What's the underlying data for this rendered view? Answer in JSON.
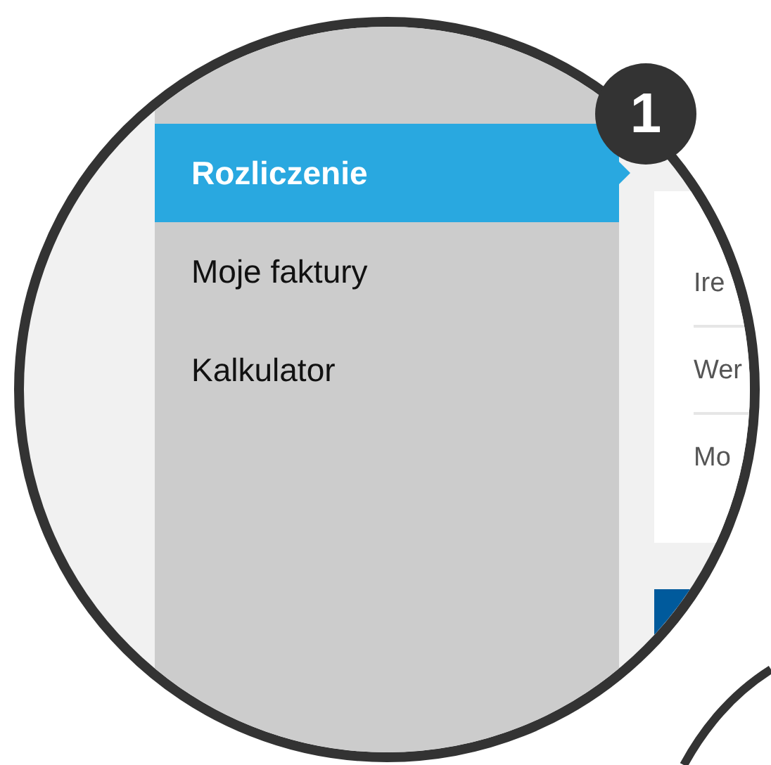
{
  "badge": {
    "label": "1"
  },
  "sidebar": {
    "items": [
      {
        "label": "Rozliczenie",
        "selected": true
      },
      {
        "label": "Moje faktury",
        "selected": false
      },
      {
        "label": "Kalkulator",
        "selected": false
      }
    ]
  },
  "list": {
    "rows": [
      "Ire",
      "Wer",
      "Mo"
    ]
  }
}
